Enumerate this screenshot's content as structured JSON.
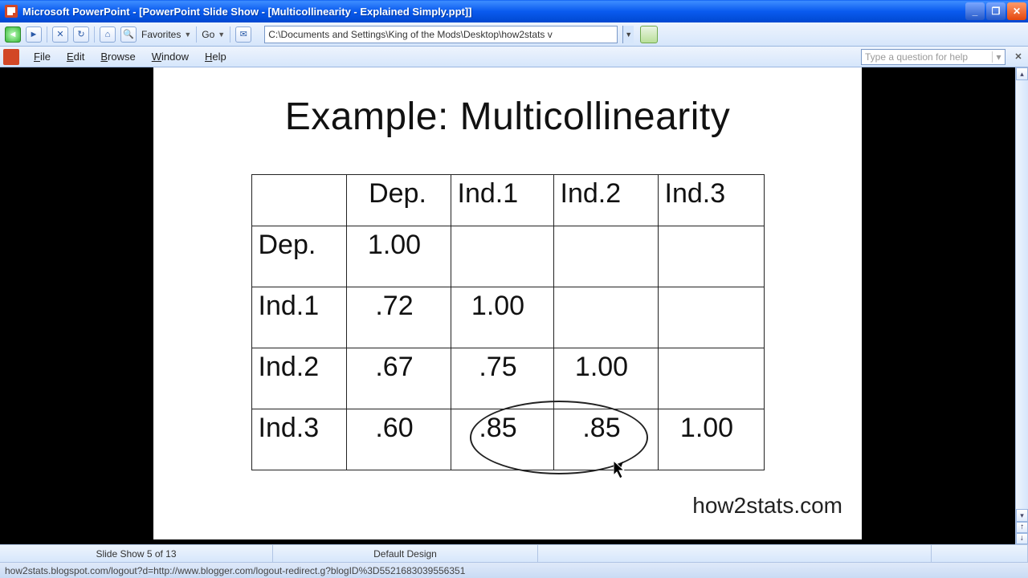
{
  "window": {
    "title": "Microsoft PowerPoint - [PowerPoint Slide Show - [Multicollinearity - Explained Simply.ppt]]"
  },
  "toolbar": {
    "favorites": "Favorites",
    "go": "Go",
    "address": "C:\\Documents and Settings\\King of the Mods\\Desktop\\how2stats v"
  },
  "menu": {
    "file": "File",
    "edit": "Edit",
    "browse": "Browse",
    "window": "Window",
    "help": "Help",
    "help_placeholder": "Type a question for help"
  },
  "slide": {
    "title": "Example: Multicollinearity",
    "headers": [
      "",
      "Dep.",
      "Ind.1",
      "Ind.2",
      "Ind.3"
    ],
    "rows": [
      {
        "label": "Dep.",
        "cells": [
          "1.00",
          "",
          "",
          ""
        ]
      },
      {
        "label": "Ind.1",
        "cells": [
          ".72",
          "1.00",
          "",
          ""
        ]
      },
      {
        "label": "Ind.2",
        "cells": [
          ".67",
          ".75",
          "1.00",
          ""
        ]
      },
      {
        "label": "Ind.3",
        "cells": [
          ".60",
          ".85",
          ".85",
          "1.00"
        ]
      }
    ],
    "footer": "how2stats.com"
  },
  "status": {
    "slide_info": "Slide Show 5 of 13",
    "design": "Default Design",
    "url": "how2stats.blogspot.com/logout?d=http://www.blogger.com/logout-redirect.g?blogID%3D5521683039556351"
  }
}
